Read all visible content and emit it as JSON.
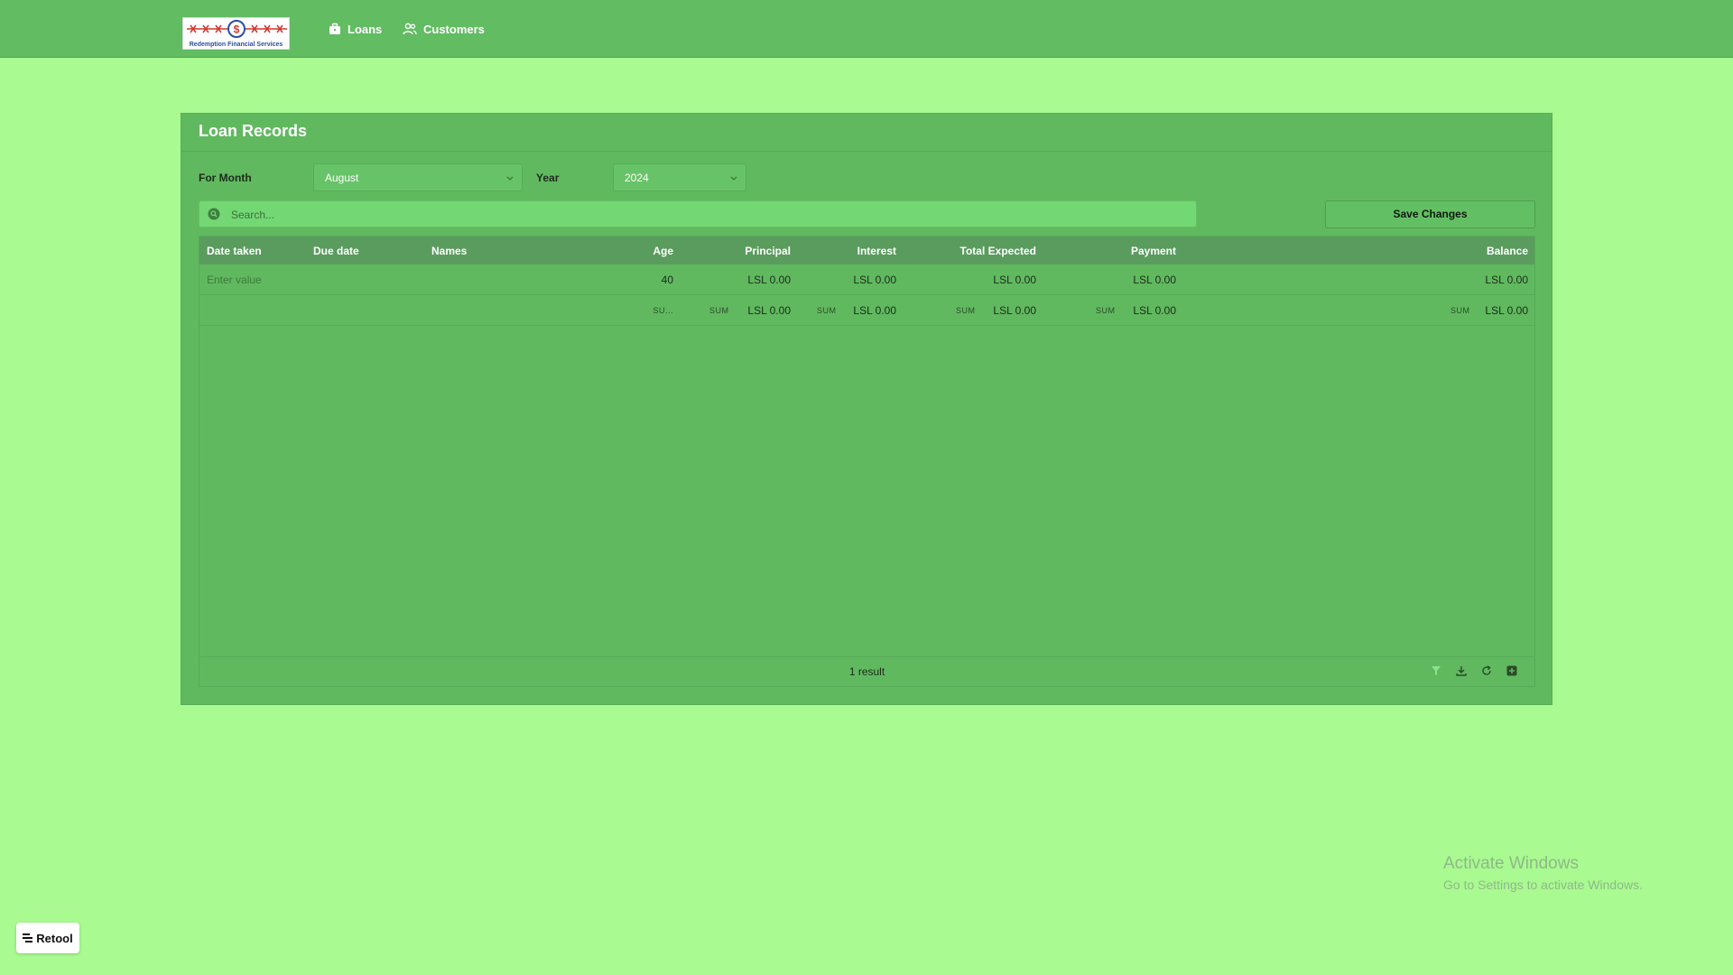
{
  "nav": {
    "brand": "Redemption Financial Services",
    "items": [
      {
        "label": "Loans",
        "icon": "briefcase-icon"
      },
      {
        "label": "Customers",
        "icon": "users-icon"
      }
    ]
  },
  "card": {
    "title": "Loan Records",
    "month_label": "For Month",
    "month_value": "August",
    "year_label": "Year",
    "year_value": "2024",
    "search_placeholder": "Search...",
    "save_label": "Save Changes"
  },
  "table": {
    "columns": [
      "Date taken",
      "Due date",
      "Names",
      "Age",
      "Principal",
      "Interest",
      "Total Expected",
      "Payment",
      "Balance"
    ],
    "rows": [
      {
        "date_taken_placeholder": "Enter value",
        "age": "40",
        "principal": "LSL 0.00",
        "interest": "LSL 0.00",
        "total_expected": "LSL 0.00",
        "payment": "LSL 0.00",
        "balance": "LSL 0.00"
      }
    ],
    "summary": {
      "age_label": "SU...",
      "sum_label": "SUM",
      "principal": "LSL 0.00",
      "interest": "LSL 0.00",
      "total_expected": "LSL 0.00",
      "payment": "LSL 0.00",
      "balance": "LSL 0.00"
    },
    "result_count": "1 result"
  },
  "watermark": {
    "title": "Activate Windows",
    "subtitle": "Go to Settings to activate Windows."
  },
  "badge": {
    "label": "Retool"
  },
  "colors": {
    "background": "#a9fa90",
    "topbar": "#61bc62",
    "card": "#60b95f",
    "table_header": "#5a9c5e",
    "search": "#73d873"
  }
}
